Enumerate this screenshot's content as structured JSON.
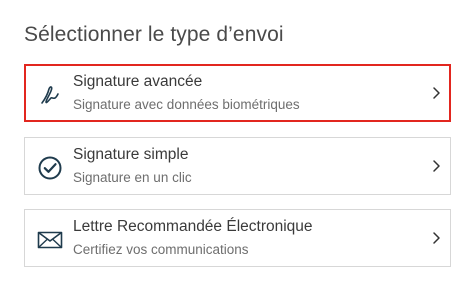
{
  "page": {
    "title": "Sélectionner le type d’envoi"
  },
  "options": [
    {
      "label": "Signature avancée",
      "description": "Signature avec données biométriques",
      "icon": "signature-pen-icon",
      "selected": true
    },
    {
      "label": "Signature simple",
      "description": "Signature en un clic",
      "icon": "check-circle-icon",
      "selected": false
    },
    {
      "label": "Lettre Recommandée Électronique",
      "description": "Certifiez vos communications",
      "icon": "envelope-icon",
      "selected": false
    }
  ],
  "colors": {
    "selected_border": "#e2261f",
    "icon": "#1f3b4d",
    "card_border": "#d7d7d7"
  }
}
